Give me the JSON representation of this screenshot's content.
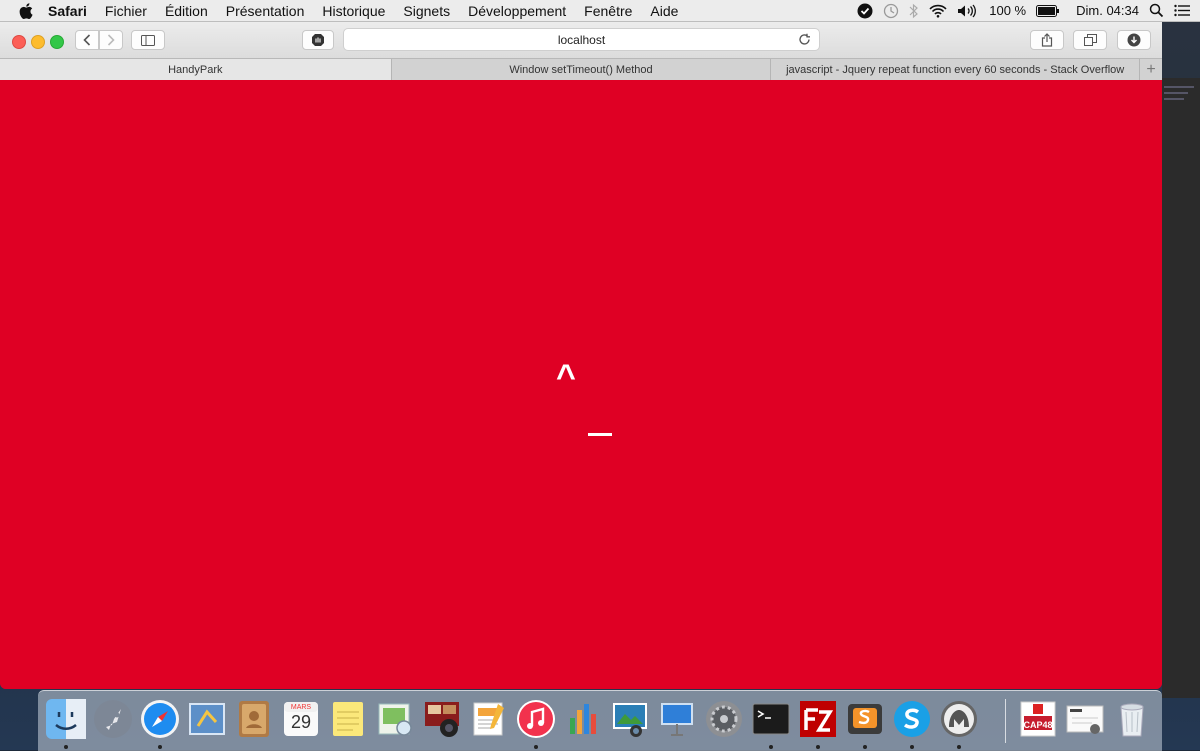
{
  "menubar": {
    "app_name": "Safari",
    "menus": [
      "Fichier",
      "Édition",
      "Présentation",
      "Historique",
      "Signets",
      "Développement",
      "Fenêtre",
      "Aide"
    ],
    "battery": "100 %",
    "clock": "Dim. 04:34"
  },
  "browser": {
    "address": "localhost",
    "tabs": [
      {
        "label": "HandyPark"
      },
      {
        "label": "Window setTimeout() Method"
      },
      {
        "label": "javascript - Jquery repeat function every 60 seconds - Stack Overflow"
      }
    ],
    "active_tab_index": 0
  },
  "page": {
    "background": "#df0024",
    "caret_text": "^"
  },
  "dock": {
    "calendar_month": "MARS",
    "calendar_day": "29",
    "cap48_label": "CAP48",
    "items": [
      "finder-icon",
      "launchpad-icon",
      "safari-icon",
      "mail-icon",
      "contacts-icon",
      "calendar-icon",
      "notes-icon",
      "preview-icon",
      "photo-booth-icon",
      "pages-icon",
      "itunes-icon",
      "numbers-icon",
      "iphoto-icon",
      "keynote-icon",
      "system-preferences-icon",
      "terminal-icon",
      "filezilla-icon",
      "sublime-text-icon",
      "skype-icon",
      "mamp-icon",
      "cap48-icon",
      "mamp-pro-icon",
      "trash-icon"
    ]
  }
}
